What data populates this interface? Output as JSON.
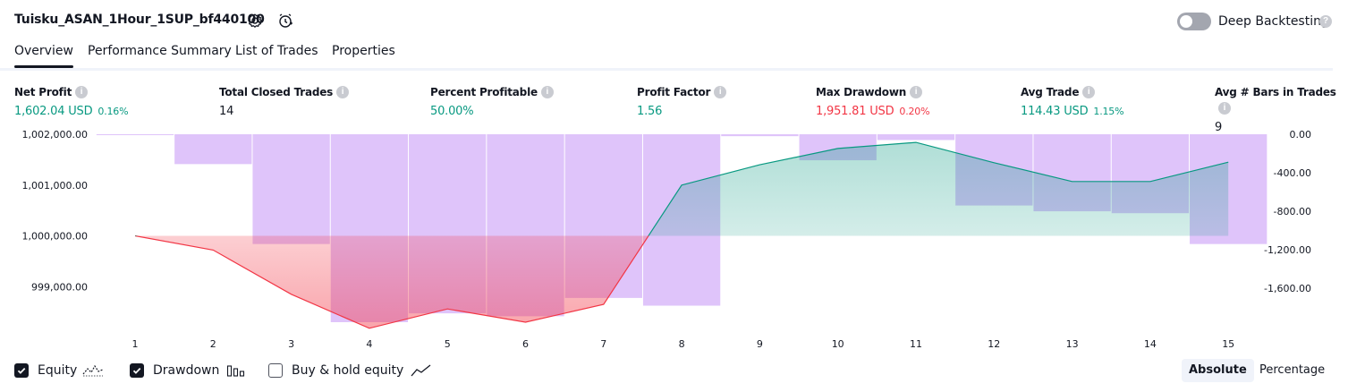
{
  "header": {
    "strategy_name": "Tuisku_ASAN_1Hour_1SUP_bf440100",
    "deep_backtesting_label": "Deep Backtesting",
    "deep_backtesting_enabled": false
  },
  "tabs": [
    {
      "label": "Overview",
      "active": true
    },
    {
      "label": "Performance Summary",
      "active": false
    },
    {
      "label": "List of Trades",
      "active": false
    },
    {
      "label": "Properties",
      "active": false
    }
  ],
  "metrics": [
    {
      "label": "Net Profit",
      "value": "1,602.04 USD",
      "sub": "0.16%",
      "tone": "green"
    },
    {
      "label": "Total Closed Trades",
      "value": "14",
      "sub": "",
      "tone": "dark"
    },
    {
      "label": "Percent Profitable",
      "value": "50.00%",
      "sub": "",
      "tone": "green"
    },
    {
      "label": "Profit Factor",
      "value": "1.56",
      "sub": "",
      "tone": "green"
    },
    {
      "label": "Max Drawdown",
      "value": "1,951.81 USD",
      "sub": "0.20%",
      "tone": "red"
    },
    {
      "label": "Avg Trade",
      "value": "114.43 USD",
      "sub": "1.15%",
      "tone": "green"
    },
    {
      "label": "Avg # Bars in Trades",
      "value": "9",
      "sub": "",
      "tone": "dark"
    }
  ],
  "chart_data": {
    "type": "line",
    "x": [
      1,
      2,
      3,
      4,
      5,
      6,
      7,
      8,
      9,
      10,
      11,
      12,
      13,
      14,
      15
    ],
    "x_tick_labels": [
      "1",
      "2",
      "3",
      "4",
      "5",
      "6",
      "7",
      "8",
      "9",
      "10",
      "11",
      "12",
      "13",
      "14",
      "15"
    ],
    "left_axis_ticks": [
      "1,002,000.00",
      "1,001,000.00",
      "1,000,000.00",
      "999,000.00"
    ],
    "right_axis_ticks": [
      "0.00",
      "-400.00",
      "-800.00",
      "-1,200.00",
      "-1,600.00"
    ],
    "baseline": 1000000,
    "y_left_lim": [
      998300,
      1002000
    ],
    "y_right_lim": [
      -1951.81,
      0
    ],
    "series": [
      {
        "name": "Equity",
        "axis": "left",
        "values": [
          1000000,
          999720,
          998850,
          998180,
          998560,
          998300,
          998650,
          1001000,
          1001400,
          1001720,
          1001840,
          1001440,
          1001070,
          1001070,
          1001450
        ],
        "color_up": "#089981",
        "color_down": "#f23645"
      },
      {
        "name": "Drawdown",
        "axis": "right",
        "type": "bar",
        "values": [
          0,
          -310,
          -1140,
          -1951.81,
          -1860,
          -1890,
          -1700,
          -1780,
          -20,
          -270,
          -60,
          -740,
          -800,
          -820,
          -1140
        ],
        "color": "#c493f5"
      }
    ],
    "legend_placement": "bottom-left",
    "grid": false
  },
  "legend": [
    {
      "label": "Equity",
      "checked": true,
      "icon": "equity-line-icon"
    },
    {
      "label": "Drawdown",
      "checked": true,
      "icon": "drawdown-bars-icon"
    },
    {
      "label": "Buy & hold equity",
      "checked": false,
      "icon": "buy-hold-line-icon"
    }
  ],
  "view_modes": [
    {
      "label": "Absolute",
      "active": true
    },
    {
      "label": "Percentage",
      "active": false
    }
  ]
}
